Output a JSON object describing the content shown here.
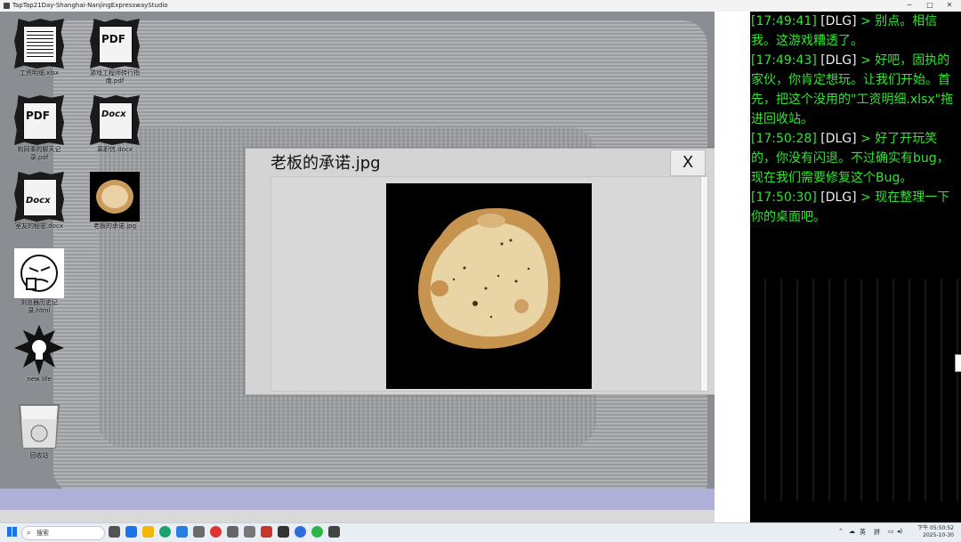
{
  "window": {
    "title": "TapTap21Day-Shanghai-NanjingExpresswayStudio",
    "minimize": "─",
    "maximize": "□",
    "close": "✕"
  },
  "desktop_icons": [
    {
      "label": "工资明细.xlsx",
      "type": "spreadsheet-icon"
    },
    {
      "label": "游戏工程师转行指南.pdf",
      "type": "pdf-icon",
      "badge": "PDF"
    },
    {
      "label": "和同事的聊天记录.pdf",
      "type": "pdf-icon",
      "badge": "PDF"
    },
    {
      "label": "离职信.docx",
      "type": "docx-icon",
      "badge": "Docx"
    },
    {
      "label": "室友的秘密.docx",
      "type": "docx-icon",
      "badge": "Docx"
    },
    {
      "label": "老板的承诺.jpg",
      "type": "image-icon"
    },
    {
      "label": "浏览器历史记录.html",
      "type": "browser-icon"
    },
    {
      "label": "new life",
      "type": "lightbulb-icon"
    },
    {
      "label": "回收站",
      "type": "recycle-bin-icon"
    }
  ],
  "viewer": {
    "title": "老板的承诺.jpg",
    "close_label": "X"
  },
  "log": [
    {
      "time": "[17:49:41]",
      "tag": "[DLG]",
      "text": "> 别点。相信我。这游戏糟透了。"
    },
    {
      "time": "[17:49:43]",
      "tag": "[DLG]",
      "text": "> 好吧，固执的家伙，你肯定想玩。让我们开始。首先，把这个没用的\"工资明细.xlsx\"拖进回收站。"
    },
    {
      "time": "[17:50:28]",
      "tag": "[DLG]",
      "text": "> 好了开玩笑的，你没有闪退。不过确实有bug，现在我们需要修复这个Bug。"
    },
    {
      "time": "[17:50:30]",
      "tag": "[DLG]",
      "text": "> 现在整理一下你的桌面吧。"
    }
  ],
  "taskbar": {
    "search_placeholder": "搜索",
    "tray_lang": "英",
    "tray_ime": "拼",
    "clock_time": "下午 05:50:52",
    "clock_date": "2025-10-30"
  },
  "colors": {
    "log_green": "#35e235",
    "log_bg": "#000000",
    "accent_blue": "#1a73e8"
  }
}
